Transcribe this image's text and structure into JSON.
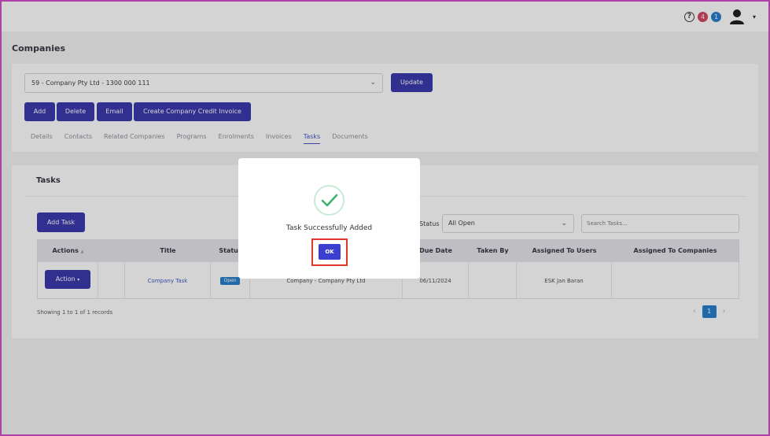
{
  "topbar": {
    "help_glyph": "?",
    "badge_red": "4",
    "badge_blue": "1",
    "badge_red_color": "#d33a5a",
    "badge_blue_color": "#1a78c8",
    "caret": "▾"
  },
  "page": {
    "title": "Companies"
  },
  "company_select": {
    "value": "59 - Company Pty Ltd - 1300 000 111",
    "chevron": "⌄"
  },
  "buttons": {
    "update": "Update",
    "add": "Add",
    "delete": "Delete",
    "email": "Email",
    "credit_invoice": "Create Company Credit Invoice"
  },
  "tabs": [
    "Details",
    "Contacts",
    "Related Companies",
    "Programs",
    "Enrolments",
    "Invoices",
    "Tasks",
    "Documents"
  ],
  "active_tab": "Tasks",
  "tasks_card": {
    "title": "Tasks",
    "add_task": "Add Task",
    "status_label": "Status",
    "status_value": "All Open",
    "search_placeholder": "Search Tasks...",
    "columns": [
      "Actions",
      "Title",
      "Status",
      "Due Date",
      "Taken By",
      "Assigned To Users",
      "Assigned To Companies"
    ],
    "sort_glyph": "▲",
    "row": {
      "action": "Action",
      "title": "Company Task",
      "status": "Open",
      "company": "Company - Company Pty Ltd",
      "due_date": "06/11/2024",
      "taken_by": "",
      "assigned_users": "ESK Jan Baran",
      "assigned_companies": ""
    },
    "records": "Showing 1 to 1 of 1 records",
    "pager": {
      "prev": "‹",
      "current": "1",
      "next": "›"
    }
  },
  "modal": {
    "message": "Task Successfully Added",
    "ok": "OK",
    "check_color": "#3cb371",
    "highlight_color": "#e0362b"
  }
}
